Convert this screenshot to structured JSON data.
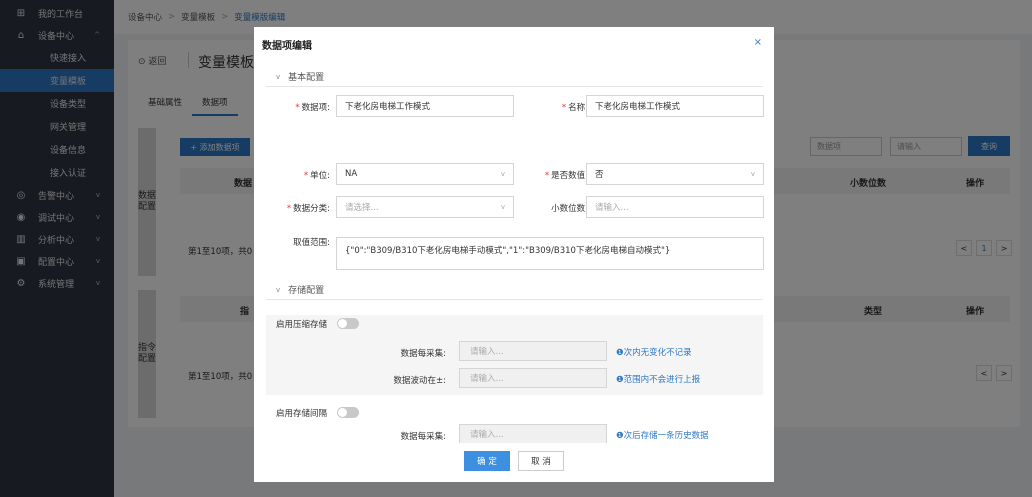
{
  "sidebar": {
    "items": [
      {
        "icon": "monitor-icon",
        "glyph": "⊞",
        "label": "我的工作台"
      },
      {
        "icon": "device-icon",
        "glyph": "⌂",
        "label": "设备中心",
        "chevron": "^"
      },
      {
        "icon": "alarm-icon",
        "glyph": "◎",
        "label": "告警中心",
        "chevron": "v"
      },
      {
        "icon": "debug-icon",
        "glyph": "◉",
        "label": "调试中心",
        "chevron": "v"
      },
      {
        "icon": "analysis-icon",
        "glyph": "▥",
        "label": "分析中心",
        "chevron": "v"
      },
      {
        "icon": "config-icon",
        "glyph": "▣",
        "label": "配置中心",
        "chevron": "v"
      },
      {
        "icon": "settings-icon",
        "glyph": "⚙",
        "label": "系统管理",
        "chevron": "v"
      }
    ],
    "sub": [
      "快速接入",
      "变量模板",
      "设备类型",
      "网关管理",
      "设备信息",
      "接入认证"
    ]
  },
  "breadcrumb": {
    "a": "设备中心",
    "b": "变量模板",
    "c": "变量模版编辑"
  },
  "page": {
    "back": "⊙ 返回",
    "title": "变量模板",
    "tabs": [
      "基础属性",
      "数据项"
    ],
    "panel1": "数据配置",
    "panel2": "指令配置",
    "add_btn": "+ 添加数据项",
    "filter_sel": "数据项",
    "filter_ph": "请输入",
    "query_btn": "查询",
    "col_data": "数据",
    "col_decimal": "小数位数",
    "col_op": "操作",
    "col_cmd": "指",
    "col_type": "类型",
    "col_op2": "操作",
    "page_info": "第1至10项，共0",
    "page_info2": "第1至10项，共0",
    "page_num": "1"
  },
  "modal": {
    "title": "数据项编辑",
    "close": "×",
    "sect_basic": "基本配置",
    "sect_storage": "存储配置",
    "f_item_label": "数据项:",
    "f_item_value": "下老化房电梯工作模式",
    "f_name_label": "名称:",
    "f_name_value": "下老化房电梯工作模式",
    "f_unit_label": "单位:",
    "f_unit_value": "NA",
    "f_numeric_label": "是否数值:",
    "f_numeric_value": "否",
    "f_cat_label": "数据分类:",
    "f_cat_ph": "请选择...",
    "f_dec_label": "小数位数:",
    "f_dec_ph": "请输入...",
    "f_range_label": "取值范围:",
    "f_range_value": "{\"0\":\"B309/B310下老化房电梯手动模式\",\"1\":\"B309/B310下老化房电梯自动模式\"}",
    "compress_label": "启用压缩存储",
    "c1_label": "数据每采集:",
    "c1_ph": "请输入...",
    "c1_hint": "❶次内无变化不记录",
    "c2_label": "数据波动在±:",
    "c2_ph": "请输入...",
    "c2_hint": "❶范围内不会进行上报",
    "interval_label": "启用存储间隔",
    "i1_label": "数据每采集:",
    "i1_ph": "请输入...",
    "i1_hint": "❶次后存储一条历史数据",
    "ok": "确 定",
    "cancel": "取 消"
  }
}
